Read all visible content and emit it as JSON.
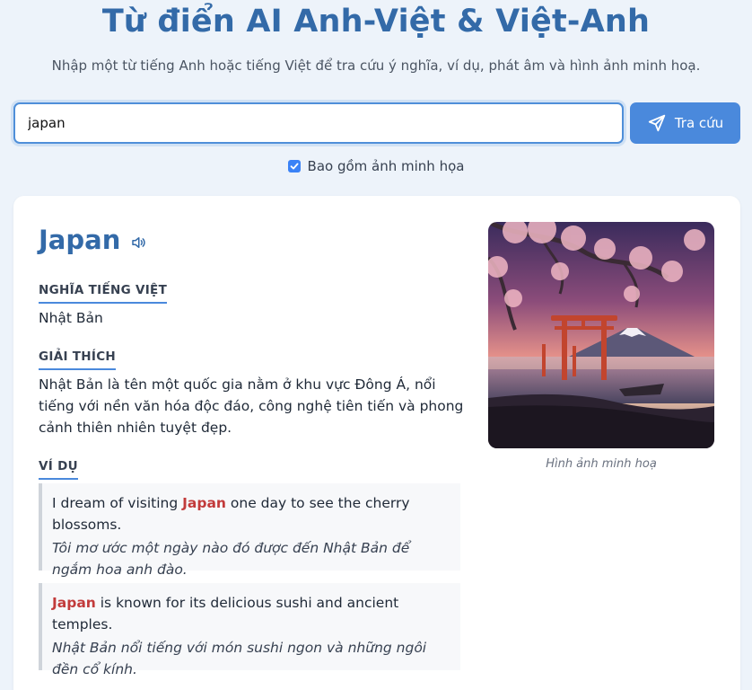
{
  "header": {
    "title": "Từ điển AI Anh-Việt & Việt-Anh",
    "subtitle": "Nhập một từ tiếng Anh hoặc tiếng Việt để tra cứu ý nghĩa, ví dụ, phát âm và hình ảnh minh hoạ."
  },
  "search": {
    "value": "japan",
    "button_label": "Tra cứu",
    "include_images_label": "Bao gồm ảnh minh họa",
    "include_images_checked": true
  },
  "entry": {
    "word": "Japan",
    "meaning_label": "NGHĨA TIẾNG VIỆT",
    "meaning": "Nhật Bản",
    "explanation_label": "GIẢI THÍCH",
    "explanation": "Nhật Bản là tên một quốc gia nằm ở khu vực Đông Á, nổi tiếng với nền văn hóa độc đáo, công nghệ tiên tiến và phong cảnh thiên nhiên tuyệt đẹp.",
    "examples_label": "VÍ DỤ",
    "examples": [
      {
        "en_before": "I dream of visiting ",
        "en_highlight": "Japan",
        "en_after": " one day to see the cherry blossoms.",
        "vi": "Tôi mơ ước một ngày nào đó được đến Nhật Bản để ngắm hoa anh đào."
      },
      {
        "en_before": "",
        "en_highlight": "Japan",
        "en_after": " is known for its delicious sushi and ancient temples.",
        "vi": "Nhật Bản nổi tiếng với món sushi ngon và những ngôi đền cổ kính."
      }
    ],
    "image_caption": "Hình ảnh minh hoạ"
  },
  "colors": {
    "accent": "#336aa8",
    "button": "#4a89dc",
    "highlight": "#c23b3b",
    "background": "#edf3fa"
  },
  "icons": {
    "search_button": "send-icon",
    "pronounce": "speaker-icon",
    "checkbox": "checkbox-icon"
  }
}
